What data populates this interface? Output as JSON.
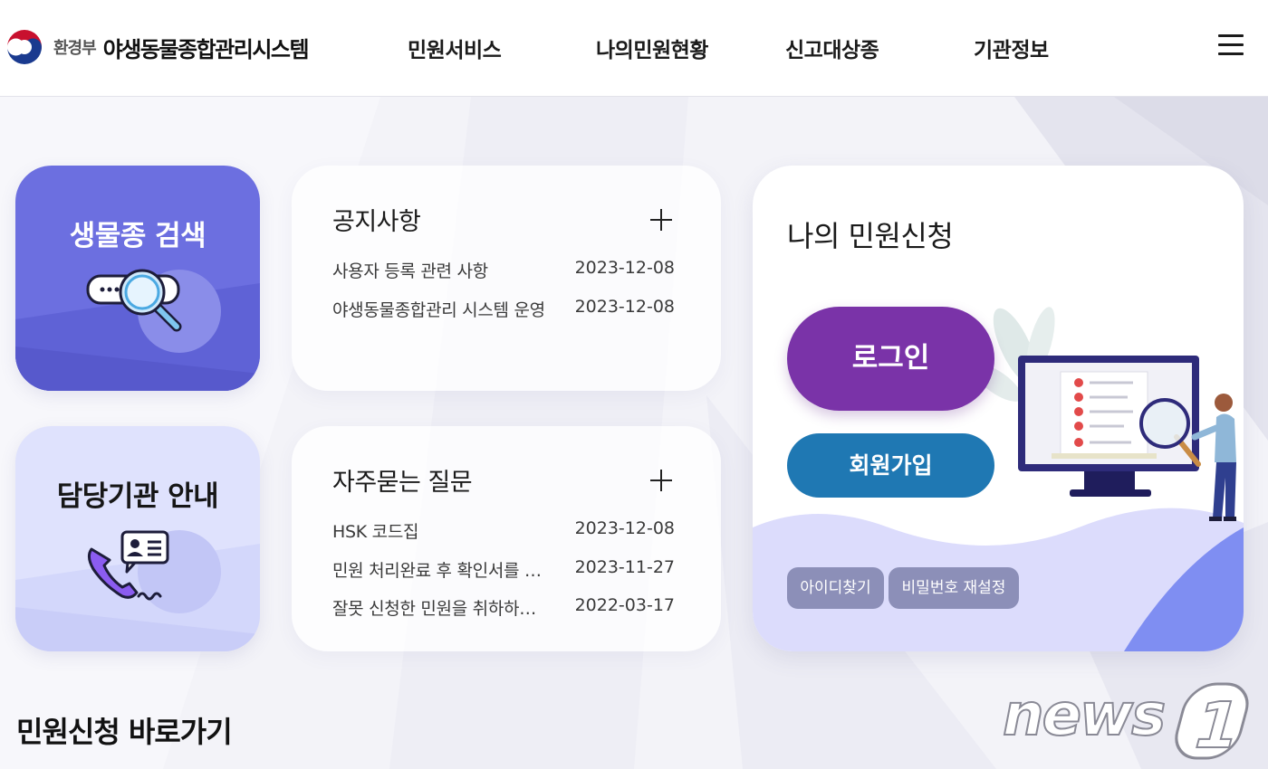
{
  "header": {
    "ministry": "환경부",
    "system_name": "야생동물종합관리시스템",
    "nav": [
      {
        "label": "민원서비스"
      },
      {
        "label": "나의민원현황"
      },
      {
        "label": "신고대상종"
      },
      {
        "label": "기관정보"
      }
    ],
    "menu_icon": "hamburger-icon"
  },
  "tiles": {
    "species_search": {
      "label": "생물종 검색",
      "icon": "magnifier-search-icon"
    },
    "agency_guide": {
      "label": "담당기관 안내",
      "icon": "phone-contact-card-icon"
    }
  },
  "notice": {
    "title": "공지사항",
    "items": [
      {
        "text": "사용자 등록 관련 사항",
        "date": "2023-12-08"
      },
      {
        "text": "야생동물종합관리 시스템 운영",
        "date": "2023-12-08"
      }
    ]
  },
  "faq": {
    "title": "자주묻는 질문",
    "items": [
      {
        "text": "HSK 코드집",
        "date": "2023-12-08"
      },
      {
        "text": "민원 처리완료 후 확인서를 …",
        "date": "2023-11-27"
      },
      {
        "text": "잘못 신청한 민원을 취하하…",
        "date": "2022-03-17"
      }
    ]
  },
  "my_application": {
    "title": "나의 민원신청",
    "login_label": "로그인",
    "signup_label": "회원가입",
    "find_id_label": "아이디찾기",
    "reset_pw_label": "비밀번호 재설정"
  },
  "shortcut": {
    "title": "민원신청 바로가기"
  },
  "watermark": {
    "text": "news1"
  },
  "colors": {
    "species_tile": "#6c6fe0",
    "agency_tile": "#dfe2fd",
    "login_button": "#7a33a8",
    "signup_button": "#1f78b3",
    "chip": "#8c8fb8"
  }
}
